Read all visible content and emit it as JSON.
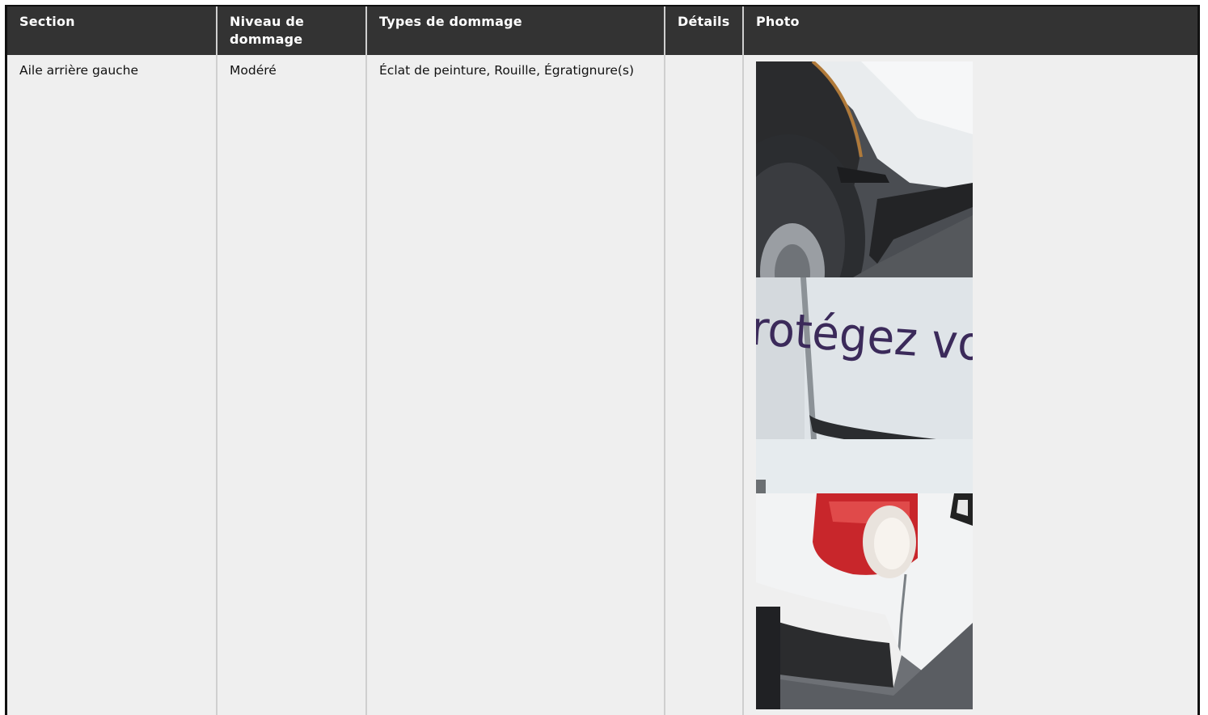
{
  "table": {
    "headers": {
      "section": "Section",
      "level": "Niveau de dommage",
      "types": "Types de dommage",
      "details": "Détails",
      "photo": "Photo"
    },
    "rows": [
      {
        "section": "Aile arrière gauche",
        "level": "Modéré",
        "types": "Éclat de peinture, Rouille, Égratignure(s)",
        "details": "",
        "photos": [
          {
            "icon": "rear-wheel-arch-photo"
          },
          {
            "icon": "side-panel-lettering-photo",
            "visible_text": "rotégez vo"
          },
          {
            "icon": "tail-light-corner-photo"
          }
        ]
      }
    ]
  }
}
